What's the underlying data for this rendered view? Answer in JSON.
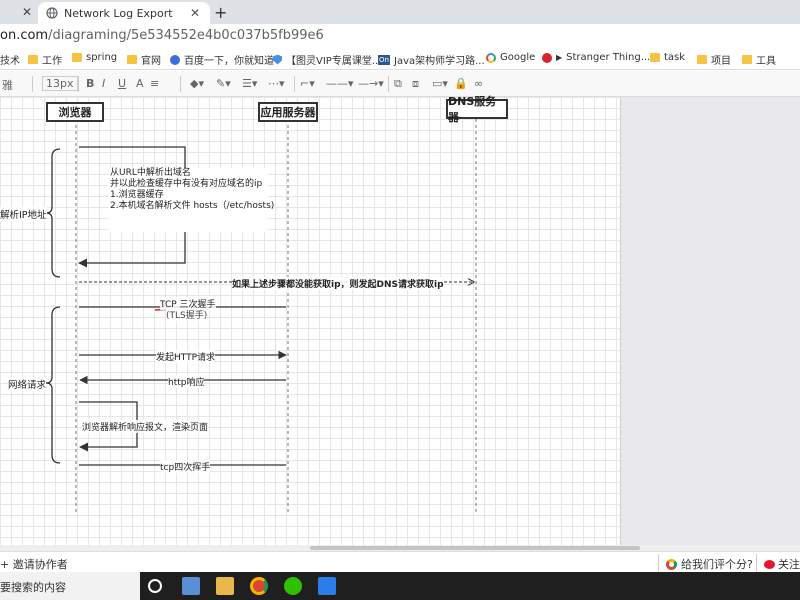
{
  "browser": {
    "tab_title": "Network Log Export",
    "url_host": "on.com",
    "url_path": "/diagraming/5e534552e4b0c037b5fb99e6"
  },
  "bookmarks": [
    {
      "label": "技术"
    },
    {
      "label": "工作"
    },
    {
      "label": "spring"
    },
    {
      "label": "官网"
    },
    {
      "label": "百度一下，你就知道"
    },
    {
      "label": "【图灵VIP专属课堂..."
    },
    {
      "label": "Java架构师学习路..."
    },
    {
      "label": "Google"
    },
    {
      "label": "Stranger Thing..."
    },
    {
      "label": "task"
    },
    {
      "label": "项目"
    },
    {
      "label": "工具"
    }
  ],
  "toolbar": {
    "font_label": "雅",
    "font_size": "13px",
    "bold": "B",
    "italic": "I",
    "underline": "U",
    "align": "A"
  },
  "diagram": {
    "lanes": {
      "browser": "浏览器",
      "app_server": "应用服务器",
      "dns_server": "DNS服务器"
    },
    "brackets": {
      "resolve_ip": "解析IP地址",
      "network_request": "网络请求"
    },
    "note_lines": [
      "从URL中解析出域名",
      "并以此检查缓存中有没有对应域名的ip",
      "1.浏览器缓存",
      "2.本机域名解析文件 hosts（/etc/hosts)"
    ],
    "messages": {
      "dns_request": "如果上述步骤都没能获取ip，则发起DNS请求获取ip",
      "tcp_handshake": "TCP 三次握手",
      "tls_handshake": "(TLS握手)",
      "http_request": "发起HTTP请求",
      "http_response": "http响应",
      "render": "浏览器解析响应报文，渲染页面",
      "tcp_close": "tcp四次挥手"
    }
  },
  "bottom": {
    "invite": "邀请协作者",
    "rate": "给我们评个分?",
    "follow": "关注"
  },
  "taskbar": {
    "search_text": "要搜索的内容"
  }
}
